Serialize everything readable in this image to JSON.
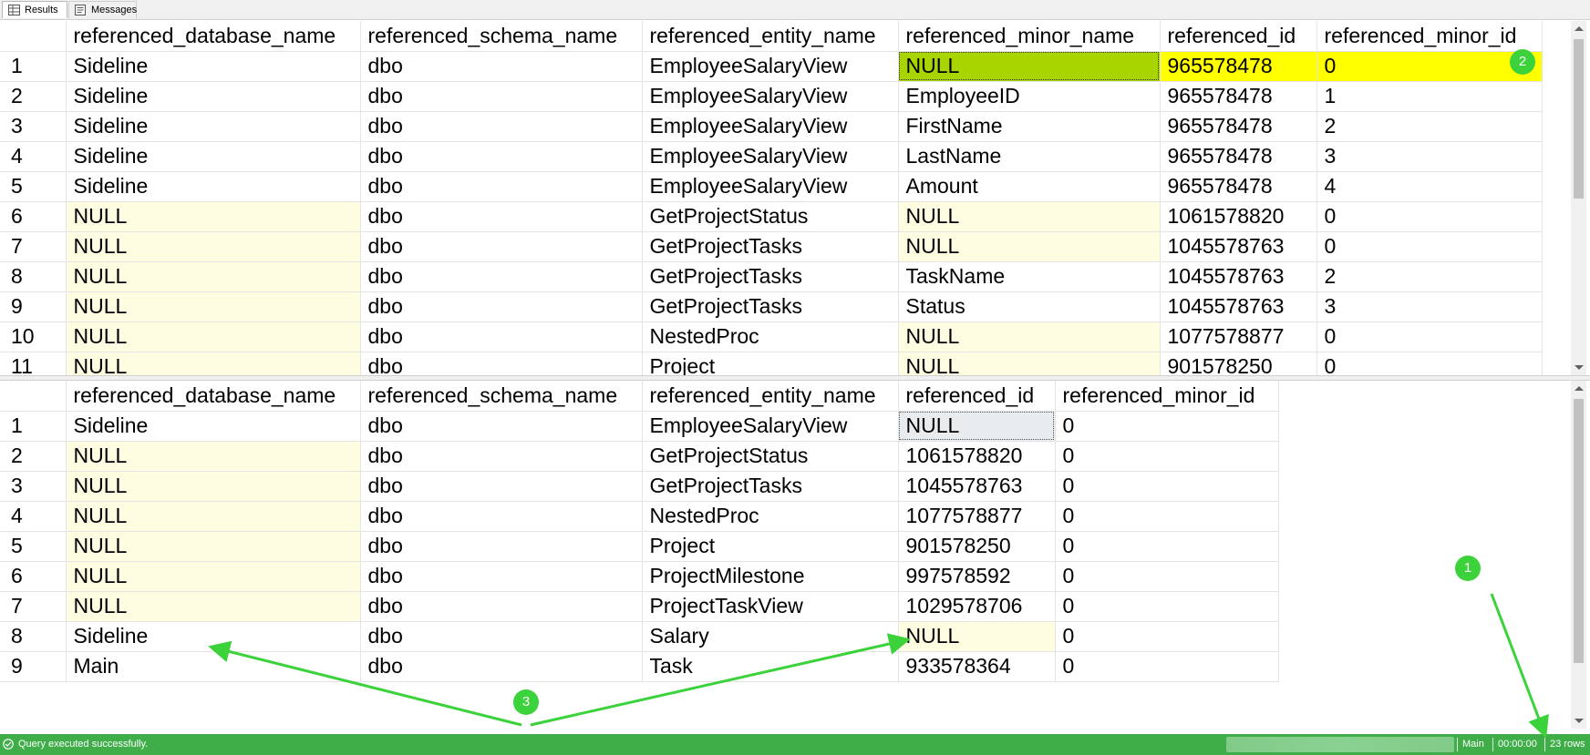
{
  "tabs": [
    {
      "label": "Results",
      "icon": "grid-icon"
    },
    {
      "label": "Messages",
      "icon": "messages-icon"
    }
  ],
  "grid1": {
    "columns": [
      "referenced_database_name",
      "referenced_schema_name",
      "referenced_entity_name",
      "referenced_minor_name",
      "referenced_id",
      "referenced_minor_id"
    ],
    "rows": [
      [
        "1",
        "Sideline",
        "dbo",
        "EmployeeSalaryView",
        "NULL",
        "965578478",
        "0"
      ],
      [
        "2",
        "Sideline",
        "dbo",
        "EmployeeSalaryView",
        "EmployeeID",
        "965578478",
        "1"
      ],
      [
        "3",
        "Sideline",
        "dbo",
        "EmployeeSalaryView",
        "FirstName",
        "965578478",
        "2"
      ],
      [
        "4",
        "Sideline",
        "dbo",
        "EmployeeSalaryView",
        "LastName",
        "965578478",
        "3"
      ],
      [
        "5",
        "Sideline",
        "dbo",
        "EmployeeSalaryView",
        "Amount",
        "965578478",
        "4"
      ],
      [
        "6",
        "NULL",
        "dbo",
        "GetProjectStatus",
        "NULL",
        "1061578820",
        "0"
      ],
      [
        "7",
        "NULL",
        "dbo",
        "GetProjectTasks",
        "NULL",
        "1045578763",
        "0"
      ],
      [
        "8",
        "NULL",
        "dbo",
        "GetProjectTasks",
        "TaskName",
        "1045578763",
        "2"
      ],
      [
        "9",
        "NULL",
        "dbo",
        "GetProjectTasks",
        "Status",
        "1045578763",
        "3"
      ],
      [
        "10",
        "NULL",
        "dbo",
        "NestedProc",
        "NULL",
        "1077578877",
        "0"
      ],
      [
        "11",
        "NULL",
        "dbo",
        "Project",
        "NULL",
        "901578250",
        "0"
      ]
    ]
  },
  "grid2": {
    "columns": [
      "referenced_database_name",
      "referenced_schema_name",
      "referenced_entity_name",
      "referenced_id",
      "referenced_minor_id"
    ],
    "rows": [
      [
        "1",
        "Sideline",
        "dbo",
        "EmployeeSalaryView",
        "NULL",
        "0"
      ],
      [
        "2",
        "NULL",
        "dbo",
        "GetProjectStatus",
        "1061578820",
        "0"
      ],
      [
        "3",
        "NULL",
        "dbo",
        "GetProjectTasks",
        "1045578763",
        "0"
      ],
      [
        "4",
        "NULL",
        "dbo",
        "NestedProc",
        "1077578877",
        "0"
      ],
      [
        "5",
        "NULL",
        "dbo",
        "Project",
        "901578250",
        "0"
      ],
      [
        "6",
        "NULL",
        "dbo",
        "ProjectMilestone",
        "997578592",
        "0"
      ],
      [
        "7",
        "NULL",
        "dbo",
        "ProjectTaskView",
        "1029578706",
        "0"
      ],
      [
        "8",
        "Sideline",
        "dbo",
        "Salary",
        "NULL",
        "0"
      ],
      [
        "9",
        "Main",
        "dbo",
        "Task",
        "933578364",
        "0"
      ]
    ]
  },
  "statusbar": {
    "message": "Query executed successfully.",
    "database": "Main",
    "elapsed": "00:00:00",
    "rows": "23 rows"
  },
  "annotations": {
    "marker_1": "1",
    "marker_2": "2",
    "marker_3": "3",
    "color": "#3cd23c"
  },
  "colors": {
    "null_cell": "#fffde1",
    "selected_row": "#ffff00",
    "selected_cell": "#a8d400",
    "status_bar": "#3fae49"
  }
}
